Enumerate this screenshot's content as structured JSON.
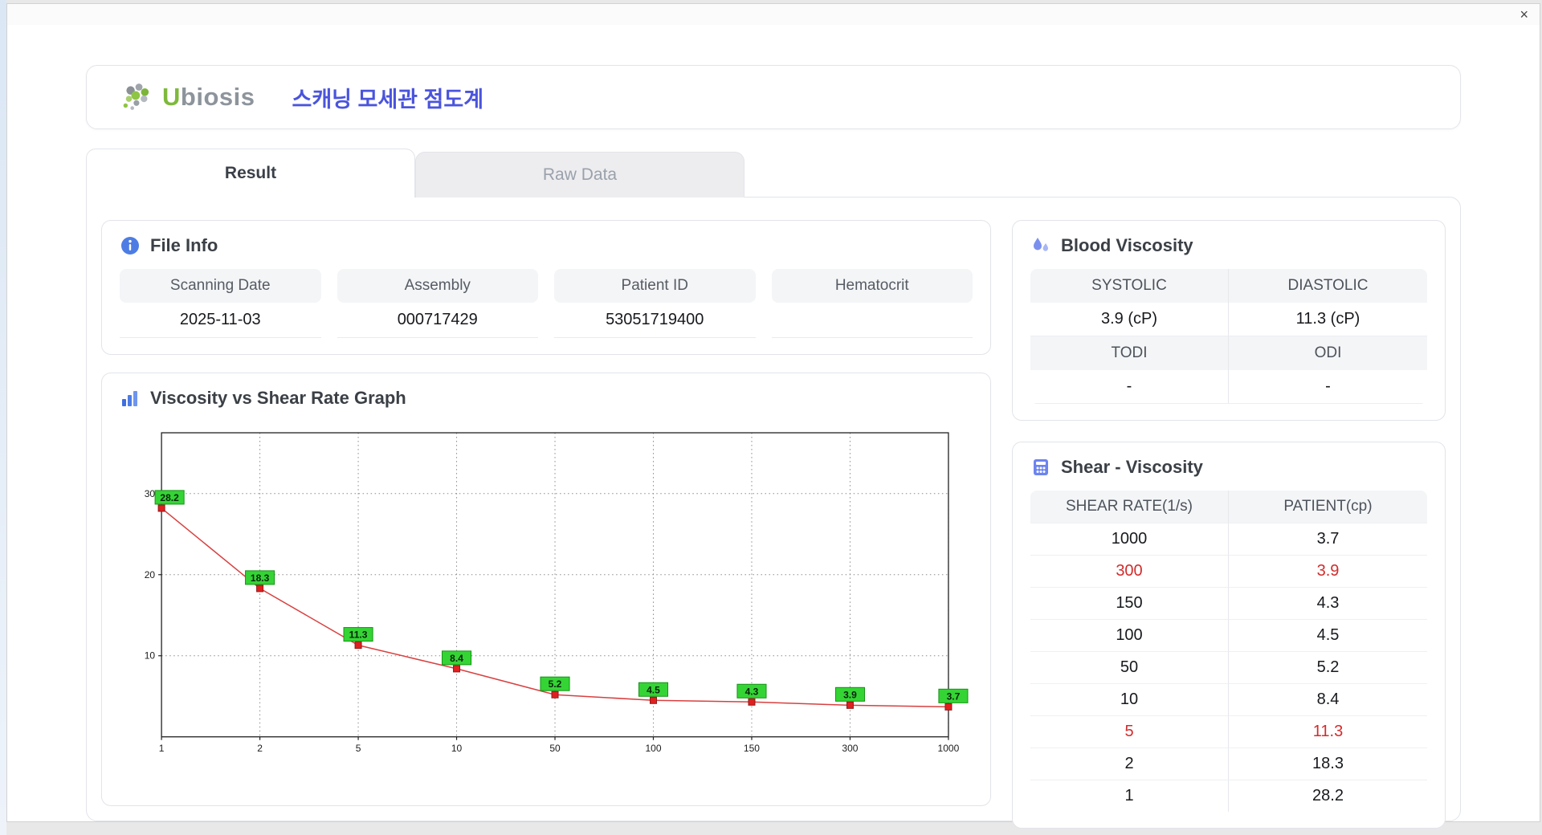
{
  "window": {
    "close_label": "×"
  },
  "header": {
    "logo_u": "U",
    "logo_rest": "biosis",
    "title": "스캐닝 모세관 점도계",
    "accent_color": "#4a54dd"
  },
  "tabs": [
    {
      "label": "Result",
      "active": true
    },
    {
      "label": "Raw Data",
      "active": false
    }
  ],
  "file_info": {
    "title": "File Info",
    "fields": [
      {
        "label": "Scanning Date",
        "value": "2025-11-03"
      },
      {
        "label": "Assembly",
        "value": "000717429"
      },
      {
        "label": "Patient ID",
        "value": "53051719400"
      },
      {
        "label": "Hematocrit",
        "value": ""
      }
    ]
  },
  "graph": {
    "title": "Viscosity vs Shear Rate Graph"
  },
  "chart_data": {
    "type": "line",
    "title": "Viscosity vs Shear Rate Graph",
    "x": [
      "1",
      "2",
      "5",
      "10",
      "50",
      "100",
      "150",
      "300",
      "1000"
    ],
    "values": [
      28.2,
      18.3,
      11.3,
      8.4,
      5.2,
      4.5,
      4.3,
      3.9,
      3.7
    ],
    "xlabel": "",
    "ylabel": "",
    "yticks": [
      10,
      20,
      30
    ],
    "ylim": [
      0,
      37.5
    ],
    "grid": "dotted",
    "x_spacing": "evenly-spaced-categories",
    "line_color": "#d84040",
    "marker_color": "#e02020",
    "marker_edge": "#8f1a1a",
    "label_bg": "#35d435",
    "label_border": "#159315"
  },
  "blood_viscosity": {
    "title": "Blood Viscosity",
    "cells": [
      {
        "label": "SYSTOLIC",
        "value": "3.9 (cP)",
        "highlight": false
      },
      {
        "label": "DIASTOLIC",
        "value": "11.3 (cP)",
        "highlight": false
      },
      {
        "label": "TODI",
        "value": "-",
        "highlight": false
      },
      {
        "label": "ODI",
        "value": "-",
        "highlight": false
      }
    ]
  },
  "shear_viscosity": {
    "title": "Shear - Viscosity",
    "columns": [
      "SHEAR RATE(1/s)",
      "PATIENT(cp)"
    ],
    "highlight_color": "#d22c2c",
    "rows": [
      {
        "rate": "1000",
        "value": "3.7",
        "highlight": false
      },
      {
        "rate": "300",
        "value": "3.9",
        "highlight": true
      },
      {
        "rate": "150",
        "value": "4.3",
        "highlight": false
      },
      {
        "rate": "100",
        "value": "4.5",
        "highlight": false
      },
      {
        "rate": "50",
        "value": "5.2",
        "highlight": false
      },
      {
        "rate": "10",
        "value": "8.4",
        "highlight": false
      },
      {
        "rate": "5",
        "value": "11.3",
        "highlight": true
      },
      {
        "rate": "2",
        "value": "18.3",
        "highlight": false
      },
      {
        "rate": "1",
        "value": "28.2",
        "highlight": false
      }
    ]
  }
}
